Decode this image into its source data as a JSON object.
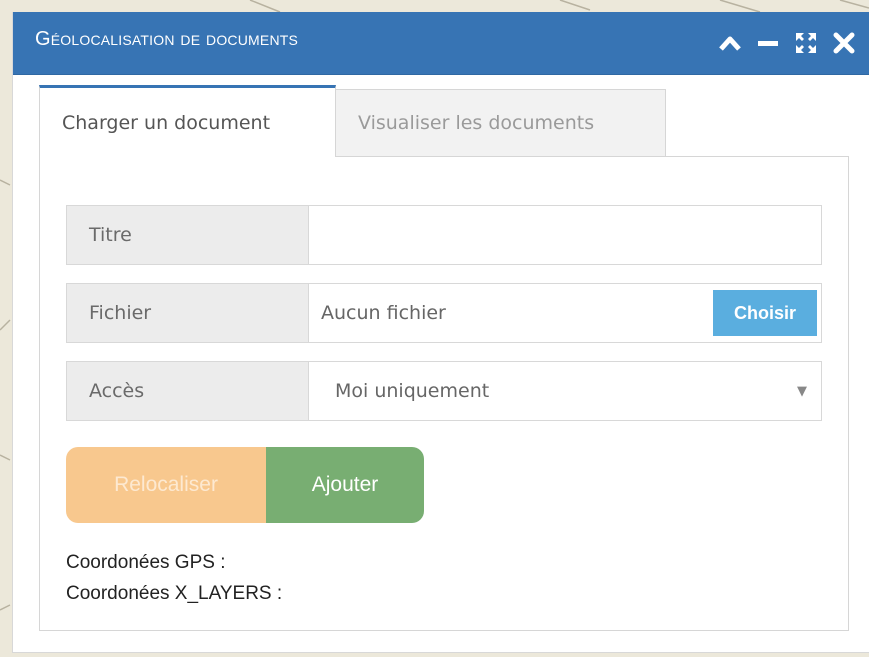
{
  "window": {
    "title": "Géolocalisation de documents",
    "accent_color": "#3774b4",
    "controls": [
      {
        "name": "collapse-icon"
      },
      {
        "name": "minimize-icon"
      },
      {
        "name": "expand-icon"
      },
      {
        "name": "close-icon"
      }
    ]
  },
  "tabs": {
    "upload_label": "Charger un document",
    "view_label": "Visualiser les documents"
  },
  "form": {
    "title_label": "Titre",
    "title_value": "",
    "file_label": "Fichier",
    "file_value": "Aucun fichier",
    "choose_label": "Choisir",
    "access_label": "Accès",
    "access_value": "Moi uniquement"
  },
  "buttons": {
    "relocate_label": "Relocaliser",
    "add_label": "Ajouter"
  },
  "coords": {
    "gps_label": "Coordonées GPS :",
    "layers_label": "Coordonées X_LAYERS :"
  },
  "icons": {
    "select_caret": "▼"
  }
}
